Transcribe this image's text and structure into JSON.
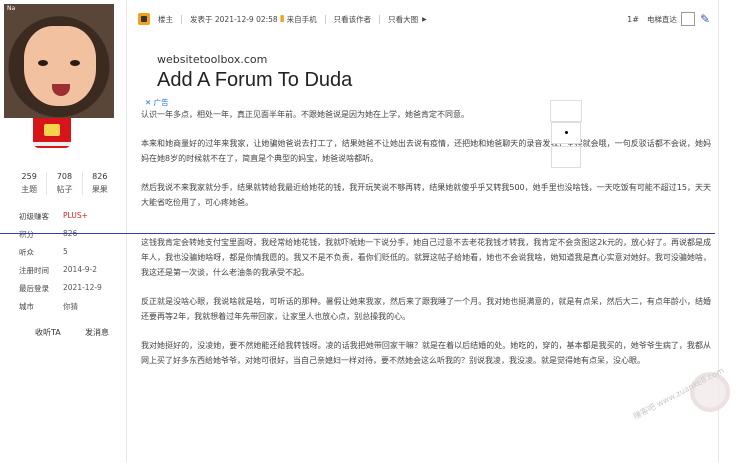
{
  "user": {
    "avatar_tag": "Na",
    "stats": [
      {
        "value": "259",
        "label": "主题"
      },
      {
        "value": "708",
        "label": "帖子"
      },
      {
        "value": "826",
        "label": "果果"
      }
    ],
    "info": [
      {
        "key": "初级赚客",
        "value": "PLUS+",
        "highlight": true
      },
      {
        "key": "积分",
        "value": "826"
      },
      {
        "key": "听众",
        "value": "5"
      },
      {
        "key": "注册时间",
        "value": "2014-9-2"
      },
      {
        "key": "最后登录",
        "value": "2021-12-9"
      },
      {
        "key": "城市",
        "value": "你猜"
      }
    ],
    "favorite_label": "收听TA",
    "message_label": "发消息"
  },
  "header": {
    "author_label": "楼主",
    "posted_at": "发表于 2021-12-9 02:58",
    "from_mobile": "来自手机",
    "only_author": "只看该作者",
    "only_large_images": "只看大图",
    "floor": "1#",
    "toolbar_label": "电梯直达"
  },
  "ad": {
    "site": "websitetoolbox.com",
    "headline": "Add A Forum To Duda",
    "label": "✕ 广告"
  },
  "post": {
    "paragraphs": [
      "认识一年多点，相处一年，真正见面半年前。不跟她爸说是因为她在上学，她爸肯定不同意。",
      "本来和她商量好的过年来我家，让她骗她爸说去打工了，结果她爸不让她出去说有疫情，还把她和她爸聊天的录音发我，全程就会哦，一句反驳话都不会说，她妈妈在她8岁的时候就不在了，简直是个典型的妈宝，她爸说啥都听。",
      "然后我说不来我家就分手，结果就转给我最近给她花的钱，我开玩笑说不够再转，结果她就傻乎乎又转我500，她手里也没啥钱，一天吃饭有可能不超过15，天天大能省吃俭用了，可心疼她爸。",
      "这钱我肯定会转她支付宝里面呀，我经常给她花钱，我就吓唬她一下说分手，她自己过意不去老花我钱才转我，我肯定不会贪图这2k元的，放心好了。再说都是成年人，我也没骗她啥呀，都是你情我愿的。我又不是不负责，看你们贬低的。就算这帖子给她看，她也不会说我啥，她知道我是真心实意对她好。我可没骗她啥，我这还是第一次谈，什么老油条的我承受不起。",
      "反正就是没啥心眼，我说啥就是啥，可听话的那种。暑假让她来我家，然后来了跟我睡了一个月。我对她也挺满意的，就是有点呆，然后大二，有点年龄小，结婚还要再等2年，我就想着过年先带回家，让家里人也放心点，别总操我的心。",
      "我对她挺好的，没凌她，要不然她能还给我转钱呀。凌的话我把她带回家干嘛？就是在着以后结婚的处。她吃的，穿的，基本都是我买的，她爷爷生病了，我都从网上买了好多东西给她爷爷，对她可很好，当自己亲媳妇一样对待，要不然她会这么听我的？别说我凌，我没凌。就是觉得她有点呆，没心眼。"
    ]
  },
  "watermark": "赚客吧  www.zuanke8.com"
}
